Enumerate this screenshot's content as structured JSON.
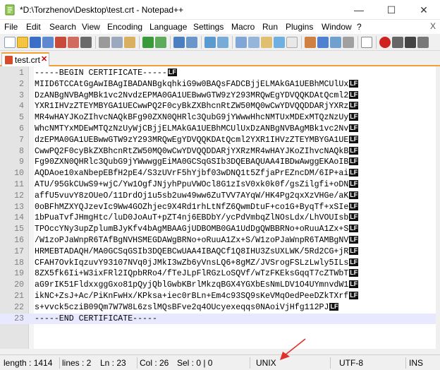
{
  "window": {
    "title": "*D:\\Torzhenov\\Desktop\\test.crt - Notepad++",
    "minimize": "—",
    "maximize": "☐",
    "close": "✕"
  },
  "menu": [
    "File",
    "Edit",
    "Search",
    "View",
    "Encoding",
    "Language",
    "Settings",
    "Macro",
    "Run",
    "Plugins",
    "Window",
    "?"
  ],
  "menu_close": "X",
  "tab": {
    "label": "test.crt",
    "close": "✕"
  },
  "eol_marker": "LF",
  "lines": [
    {
      "n": "1",
      "text": "-----BEGIN CERTIFICATE-----",
      "eol": true
    },
    {
      "n": "2",
      "text": "MIID6TCCAtGgAwIBAgIBADANBgkqhkiG9w0BAQsFADCBjjELMAkGA1UEBhMCUlUx",
      "eol": true
    },
    {
      "n": "3",
      "text": "DzANBgNVBAgMBk1vc2NvdzEPMA0GA1UEBwwGTW9zY293MRQwEgYDVQQKDAtQcml2",
      "eol": true
    },
    {
      "n": "4",
      "text": "YXR1IHVzZTEYMBYGA1UECwwPQ2F0cyBkZXBhcnRtZW50MQ0wCwYDVQQDDARjYXRz",
      "eol": true
    },
    {
      "n": "5",
      "text": "MR4wHAYJKoZIhvcNAQkBFg90ZXN0QHRlc3QubG9jYWwwHhcNMTUxMDExMTQzNzUy",
      "eol": true
    },
    {
      "n": "6",
      "text": "WhcNMTYxMDEwMTQzNzUyWjCBjjELMAkGA1UEBhMCUlUxDzANBgNVBAgMBk1vc2Nv",
      "eol": true
    },
    {
      "n": "7",
      "text": "dzEPMA0GA1UEBwwGTW9zY293MRQwEgYDVQQKDAtQcml2YXR1IHVzZTEYMBYGA1UE",
      "eol": true
    },
    {
      "n": "8",
      "text": "CwwPQ2F0cyBkZXBhcnRtZW50MQ0wCwYDVQQDDARjYXRzMR4wHAYJKoZIhvcNAQkB",
      "eol": true
    },
    {
      "n": "9",
      "text": "Fg90ZXN0QHRlc3QubG9jYWwwggEiMA0GCSqGSIb3DQEBAQUAA4IBDwAwggEKAoIB",
      "eol": true
    },
    {
      "n": "10",
      "text": "AQDAoe10xaNbepEBfH2pE4/S3zUVrF5hYjbf03wDNQ1t5ZfjaPrEZncDM/6IP+ai",
      "eol": true
    },
    {
      "n": "11",
      "text": "ATU/95GkCUwS9+wjC/Yw1OgfJNjyhPpuVWOcl8G1zIsV0xk0k0f/gsZilgfi+oDN",
      "eol": true
    },
    {
      "n": "12",
      "text": "affU5vuvY8zOUeO/11DrdOj1u5sb2uw49ww6ZuTVV7AYqW/HK4Pg2qxXzVHGe/aK",
      "eol": true
    },
    {
      "n": "13",
      "text": "0oBFhMZXYQJzevIc9Ww4GOZhjec9X4Rd1rhLtNfZ6QwmDtuF+co1G+ByqTf+xSIe",
      "eol": true
    },
    {
      "n": "14",
      "text": "1bPuaTvfJHmgHtc/luD0JoAuT+pZT4nj6EBDbY/ycPdVmbqZlNOsLdx/LhVOUIsb",
      "eol": true
    },
    {
      "n": "15",
      "text": "TPOccYNy3upZplumBJyKfv4bAgMBAAGjUDBOMB0GA1UdDgQWBBRNo+oRuuA1Zx+S",
      "eol": true
    },
    {
      "n": "16",
      "text": "/W1zoPJaWnpR6TAfBgNVHSMEGDAWgBRNo+oRuuA1Zx+S/W1zoPJaWnpR6TAMBgNV",
      "eol": true
    },
    {
      "n": "17",
      "text": "HRMEBTADAQH/MA0GCSqGSIb3DQEBCwUAA4IBAQCf1Q8IHU3ZsUXLWK/5Rd2CG+jR",
      "eol": true
    },
    {
      "n": "18",
      "text": "CFAH7OvkIqzuvY93107NVq0jJMkI3wZb6yVnsLQ6+8gMZ/JVSrogFSLzLwly5ILs",
      "eol": true
    },
    {
      "n": "19",
      "text": "8ZX5fk6Ii+W3ixFRl2IQpbRRo4/fTeJLpFlRGzLoSQVf/wTzFKEksGqqT7cZTWbT",
      "eol": true
    },
    {
      "n": "20",
      "text": "aG9rIK51FldxxggGxo81pQyjQblGwbKBrlMkzqBGX4YGXbEsNmLDV1O4UYmnvdW1",
      "eol": true
    },
    {
      "n": "21",
      "text": "ikNC+ZsJ+Ac/PiKnFwHx/KPksa+iec0rBLn+Em4c93SQ9sKeVMqOedPeeDZkTXrf",
      "eol": true
    },
    {
      "n": "22",
      "text": "s+vvck5cziB09Qm7W7W8L6zslMQsBFve2q4OUcyexeqqs0NAoiVjHfg112PJ",
      "eol": true
    },
    {
      "n": "23",
      "text": "-----END CERTIFICATE-----",
      "eol": false
    }
  ],
  "status": {
    "length": "length : 1414",
    "lines": "lines : 2",
    "ln": "Ln : 23",
    "col": "Col : 26",
    "sel": "Sel : 0 | 0",
    "eol_format": "UNIX",
    "encoding": "UTF-8",
    "mode": "INS"
  },
  "colors": {
    "accent_tab": "#f2a036",
    "annotation_arrow": "#e0302a"
  }
}
